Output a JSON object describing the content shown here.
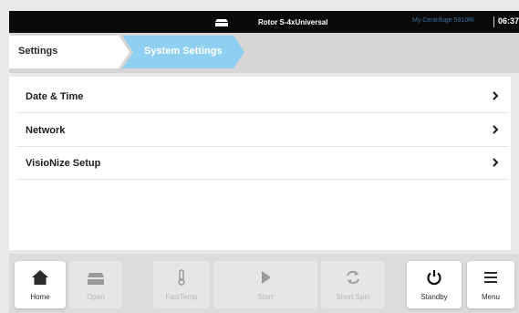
{
  "statusbar": {
    "rotor_icon": "rotor-icon",
    "rotor_name": "Rotor S-4xUniversal",
    "device_name": "My Centrifuge 5910Ri",
    "time": "06:37"
  },
  "breadcrumb": {
    "settings_label": "Settings",
    "system_settings_label": "System Settings"
  },
  "settings_list": {
    "items": [
      {
        "label": "Date & Time",
        "icon": "chevron-right-icon"
      },
      {
        "label": "Network",
        "icon": "chevron-right-icon"
      },
      {
        "label": "VisioNize Setup",
        "icon": "chevron-right-icon"
      }
    ]
  },
  "toolbar": {
    "home_label": "Home",
    "open_label": "Open",
    "fasttemp_label": "FastTemp",
    "start_label": "Start",
    "short_spin_label": "Short Spin",
    "standby_label": "Standby",
    "menu_label": "Menu"
  },
  "colors": {
    "accent": "#8fd0f2",
    "statusbar_bg": "#0a0a0a",
    "device_name": "#3d6d9e",
    "disabled_text": "#b7b7b7"
  }
}
